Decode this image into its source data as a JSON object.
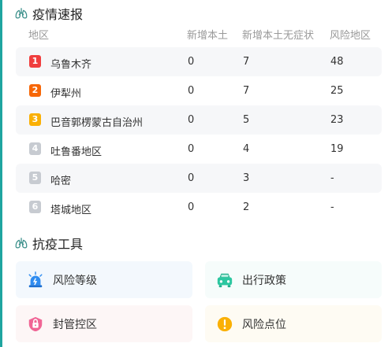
{
  "epidemic": {
    "title": "疫情速报",
    "headers": {
      "region": "地区",
      "new_local": "新增本土",
      "new_asym": "新增本土无症状",
      "risk": "风险地区"
    },
    "rows": [
      {
        "rank": "1",
        "rank_color": "#f03e3e",
        "name": "乌鲁木齐",
        "new_local": "0",
        "new_asym": "7",
        "risk": "48"
      },
      {
        "rank": "2",
        "rank_color": "#f76707",
        "name": "伊犁州",
        "new_local": "0",
        "new_asym": "7",
        "risk": "25"
      },
      {
        "rank": "3",
        "rank_color": "#fab005",
        "name": "巴音郭楞蒙古自治州",
        "new_local": "0",
        "new_asym": "5",
        "risk": "23"
      },
      {
        "rank": "4",
        "rank_color": "#c7cbd1",
        "name": "吐鲁番地区",
        "new_local": "0",
        "new_asym": "4",
        "risk": "19"
      },
      {
        "rank": "5",
        "rank_color": "#c7cbd1",
        "name": "哈密",
        "new_local": "0",
        "new_asym": "3",
        "risk": "-"
      },
      {
        "rank": "6",
        "rank_color": "#c7cbd1",
        "name": "塔城地区",
        "new_local": "0",
        "new_asym": "2",
        "risk": "-"
      }
    ]
  },
  "tools": {
    "title": "抗疫工具",
    "items": [
      {
        "label": "风险等级",
        "icon": "alarm-icon",
        "color": "#2f8cf0"
      },
      {
        "label": "出行政策",
        "icon": "car-icon",
        "color": "#2cc7a0"
      },
      {
        "label": "封管控区",
        "icon": "lockdown-icon",
        "color": "#f06595"
      },
      {
        "label": "风险点位",
        "icon": "warning-icon",
        "color": "#fab005"
      }
    ]
  },
  "colors": {
    "accent": "#1fa5a0"
  }
}
